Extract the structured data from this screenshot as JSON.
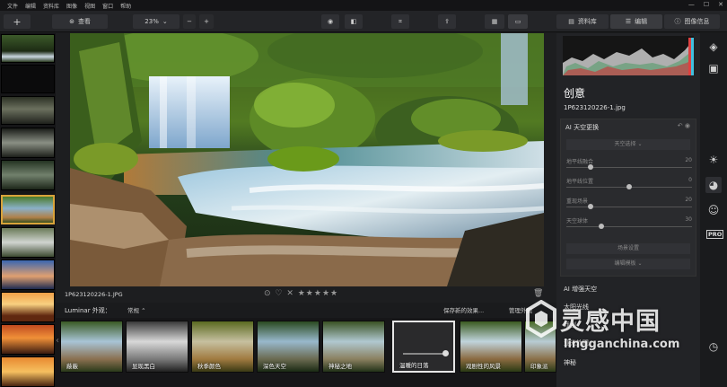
{
  "menu": [
    "文件",
    "编辑",
    "资料库",
    "图像",
    "视图",
    "窗口",
    "帮助"
  ],
  "toolbar": {
    "view_label": "查看",
    "zoom": "23%",
    "library_tab": "资料库",
    "edit_tab": "编辑",
    "info_tab": "图像信息"
  },
  "photo": {
    "filename": "1P623120226-1.JPG"
  },
  "rating_glyphs": "⊙ ♡  ✕ ★★★★★",
  "looks": {
    "label": "Luminar 外观：",
    "select": "常规",
    "save_label": "保存新的效果...",
    "manage_label": "管理外观",
    "items": [
      {
        "name": "蔽蔽"
      },
      {
        "name": "显现黑白"
      },
      {
        "name": "秋季颜色"
      },
      {
        "name": "深色天空"
      },
      {
        "name": "神秘之地"
      },
      {
        "name": "温暖的日落"
      },
      {
        "name": "戏剧性的风景"
      },
      {
        "name": "印象派"
      }
    ]
  },
  "panel": {
    "title": "创意",
    "filename": "1P623120226-1.jpg",
    "ai_sky": {
      "title": "AI 天空更换",
      "select": "天空选择 ⌄",
      "sliders": [
        {
          "label": "地平线融合",
          "value": "20",
          "pos": 0.18
        },
        {
          "label": "地平线位置",
          "value": "0",
          "pos": 0.5
        },
        {
          "label": "重现场景",
          "value": "20",
          "pos": 0.18
        },
        {
          "label": "天空球体",
          "value": "30",
          "pos": 0.27
        }
      ],
      "mask_btn": "场景设置",
      "sky_btn": "编辑模板 ⌄"
    },
    "items": [
      "AI 增强天空",
      "太阳光线",
      "戏剧",
      "亚光外观",
      "神秘"
    ]
  },
  "watermark": {
    "text": "灵感中国",
    "url": "lingganchina.com"
  },
  "colors": {
    "accent": "#d9a33a",
    "bg": "#1b1c1e"
  }
}
